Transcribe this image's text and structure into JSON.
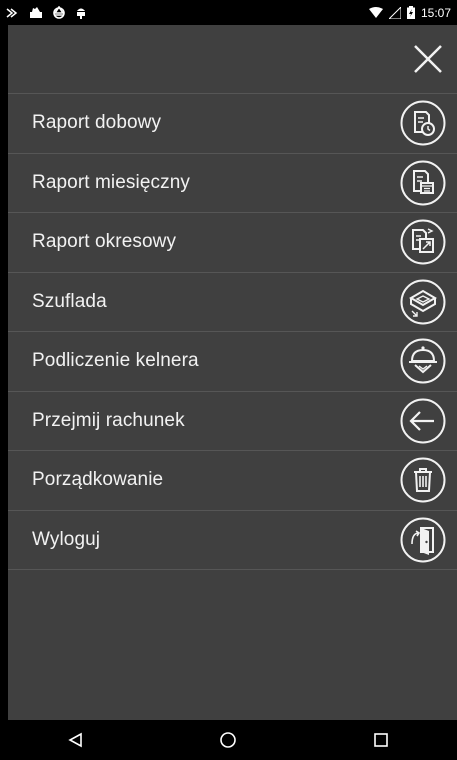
{
  "status_bar": {
    "time": "15:07",
    "left_icons": [
      "notification-icon",
      "cake-icon",
      "recycle-icon",
      "android-icon"
    ],
    "right_icons": [
      "wifi-icon",
      "signal-icon",
      "battery-icon"
    ]
  },
  "header": {
    "close_icon": "close-icon"
  },
  "menu": {
    "items": [
      {
        "label": "Raport dobowy",
        "icon": "daily-report-icon"
      },
      {
        "label": "Raport miesięczny",
        "icon": "monthly-report-icon"
      },
      {
        "label": "Raport okresowy",
        "icon": "period-report-icon"
      },
      {
        "label": "Szuflada",
        "icon": "drawer-icon"
      },
      {
        "label": "Podliczenie kelnera",
        "icon": "waiter-tally-icon"
      },
      {
        "label": "Przejmij rachunek",
        "icon": "take-over-bill-icon"
      },
      {
        "label": "Porządkowanie",
        "icon": "trash-icon"
      },
      {
        "label": "Wyloguj",
        "icon": "logout-icon"
      }
    ]
  },
  "nav_bar": {
    "buttons": [
      "back-icon",
      "home-icon",
      "recents-icon"
    ]
  },
  "colors": {
    "background": "#404040",
    "divider": "#565656",
    "text": "#f2f2f2",
    "status_bar": "#000000"
  }
}
